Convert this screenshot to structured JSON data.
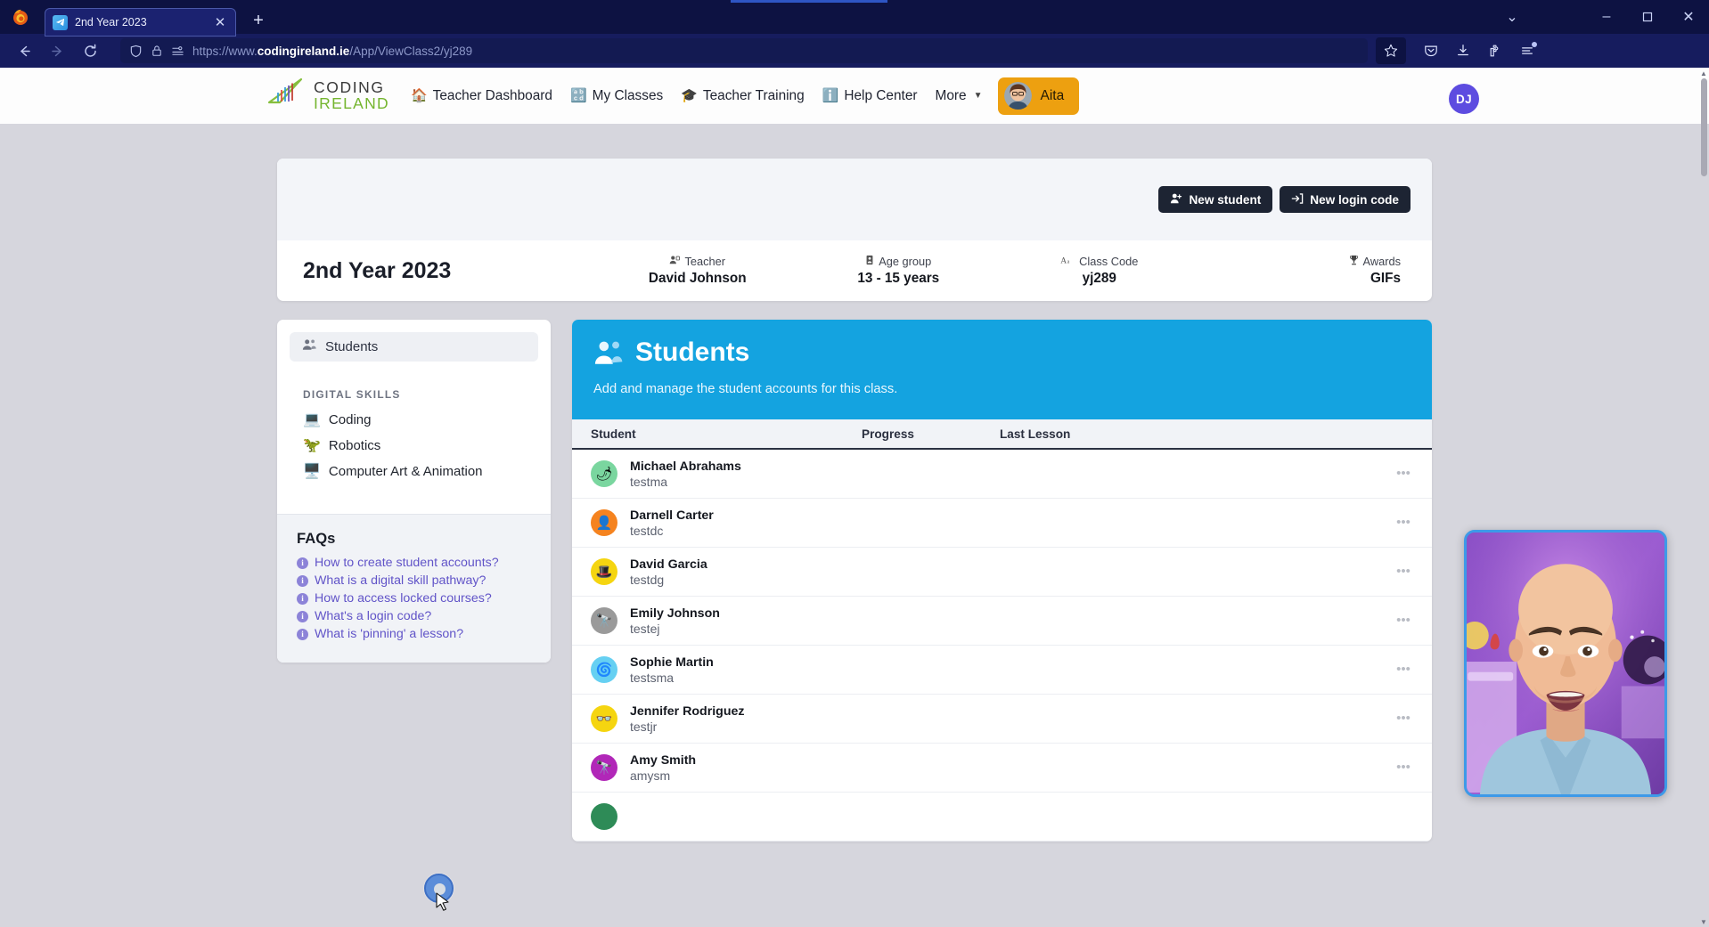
{
  "browser": {
    "tab": {
      "title": "2nd Year 2023",
      "favicon": "paper-plane-icon",
      "close": "✕"
    },
    "new_tab_label": "+",
    "url": {
      "prefix": "https://www.",
      "domain": "codingireland.ie",
      "path": "/App/ViewClass2/yj289"
    },
    "window_controls": {
      "minimize": "–",
      "maximize": "▢",
      "close": "✕",
      "list_all_tabs": "⌄"
    },
    "toolbar_icons": [
      "shield-icon",
      "lock-icon",
      "permissions-icon",
      "bookmark-star-icon",
      "pocket-icon",
      "downloads-icon",
      "extensions-icon",
      "app-menu-icon"
    ]
  },
  "header": {
    "logo": {
      "line1": "CODING",
      "line2": "IRELAND"
    },
    "nav": [
      {
        "label": "Teacher Dashboard",
        "icon": "house-icon"
      },
      {
        "label": "My Classes",
        "icon": "grid-icon"
      },
      {
        "label": "Teacher Training",
        "icon": "graduation-cap-icon"
      },
      {
        "label": "Help Center",
        "icon": "info-icon"
      },
      {
        "label": "More",
        "icon": "chevron-down-icon"
      }
    ],
    "assistant_button": {
      "label": "Aita",
      "color": "#eda010"
    },
    "user_avatar": {
      "initials": "DJ",
      "color": "#5d4ce0"
    }
  },
  "class_card": {
    "actions": [
      {
        "label": "New student",
        "icon": "user-plus-icon"
      },
      {
        "label": "New login code",
        "icon": "login-arrow-icon"
      }
    ],
    "title": "2nd Year 2023",
    "meta": [
      {
        "label": "Teacher",
        "value": "David Johnson",
        "icon": "teacher-icon"
      },
      {
        "label": "Age group",
        "value": "13 - 15 years",
        "icon": "id-card-icon"
      },
      {
        "label": "Class Code",
        "value": "yj289",
        "icon": "font-size-icon"
      },
      {
        "label": "Awards",
        "value": "GIFs",
        "icon": "trophy-icon"
      }
    ]
  },
  "sidebar": {
    "active_item": {
      "label": "Students",
      "icon": "people-icon"
    },
    "group_label": "DIGITAL SKILLS",
    "items": [
      {
        "label": "Coding",
        "icon": "laptop-icon",
        "emoji": "💻"
      },
      {
        "label": "Robotics",
        "icon": "robot-icon",
        "emoji": "🐴"
      },
      {
        "label": "Computer Art & Animation",
        "icon": "art-monitor-icon",
        "emoji": "🖥"
      }
    ],
    "faq": {
      "title": "FAQs",
      "items": [
        "How to create student accounts?",
        "What is a digital skill pathway?",
        "How to access locked courses?",
        "What's a login code?",
        "What is 'pinning' a lesson?"
      ]
    }
  },
  "main": {
    "hero": {
      "title": "Students",
      "subtitle": "Add and manage the student accounts for this class.",
      "icon": "people-icon",
      "color": "#14a3e0"
    },
    "table": {
      "columns": [
        "Student",
        "Progress",
        "Last Lesson"
      ],
      "menu_icon": "kebab-menu-icon",
      "rows": [
        {
          "name": "Michael Abrahams",
          "username": "testma",
          "avatar_color": "#7ad69f",
          "avatar_glyph": "🌶",
          "progress": "",
          "last_lesson": ""
        },
        {
          "name": "Darnell Carter",
          "username": "testdc",
          "avatar_color": "#f5831f",
          "avatar_glyph": "👤",
          "progress": "",
          "last_lesson": ""
        },
        {
          "name": "David Garcia",
          "username": "testdg",
          "avatar_color": "#f5d510",
          "avatar_glyph": "🎩",
          "progress": "",
          "last_lesson": ""
        },
        {
          "name": "Emily Johnson",
          "username": "testej",
          "avatar_color": "#9a9a9a",
          "avatar_glyph": "🔭",
          "progress": "",
          "last_lesson": ""
        },
        {
          "name": "Sophie Martin",
          "username": "testsma",
          "avatar_color": "#66d0f2",
          "avatar_glyph": "🌀",
          "progress": "",
          "last_lesson": ""
        },
        {
          "name": "Jennifer Rodriguez",
          "username": "testjr",
          "avatar_color": "#f5d510",
          "avatar_glyph": "👓",
          "progress": "",
          "last_lesson": ""
        },
        {
          "name": "Amy Smith",
          "username": "amysm",
          "avatar_color": "#b127b8",
          "avatar_glyph": "🔭",
          "progress": "",
          "last_lesson": ""
        }
      ]
    }
  },
  "overlay": {
    "webcam": "presenter-video",
    "click_indicator": "click-highlight"
  }
}
